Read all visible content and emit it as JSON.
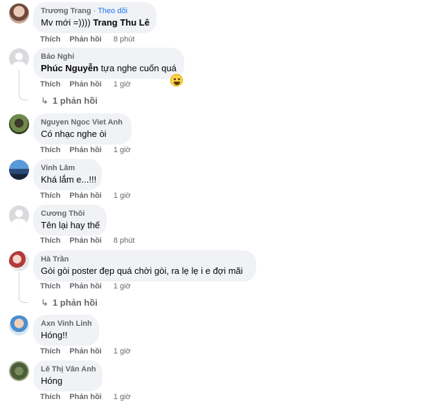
{
  "labels": {
    "like": "Thích",
    "reply": "Phản hồi"
  },
  "comments": [
    {
      "name": "Trương Trang",
      "follow": "· Theo dõi",
      "text": "Mv mới =)))) ",
      "mention": "Trang Thu Lê",
      "time": "8 phút"
    },
    {
      "name": "Bảo Nghi",
      "mention": "Phúc Nguyễn",
      "text": " tựa nghe cuốn quá",
      "time": "1 giờ",
      "replies": "1 phản hồi"
    },
    {
      "name": "Nguyen Ngoc Viet Anh",
      "text": "Có nhạc nghe òi",
      "time": "1 giờ"
    },
    {
      "name": "Vinh Lâm",
      "text": "Khá lắm e...!!!",
      "time": "1 giờ"
    },
    {
      "name": "Cương Thôi",
      "text": "Tên lại hay thế",
      "time": "8 phút"
    },
    {
      "name": "Hà Trần",
      "text": "Gòi gòi poster đẹp quá chời gòi, ra lẹ lẹ i e đợi mãi",
      "time": "1 giờ",
      "replies": "1 phản hồi"
    },
    {
      "name": "Axn Vinh Linh",
      "text": "Hóng!!",
      "time": "1 giờ"
    },
    {
      "name": "Lê Thị Vân Anh",
      "text": "Hóng",
      "time": "1 giờ"
    }
  ],
  "reaction_icon": "laughing-emoji-icon"
}
